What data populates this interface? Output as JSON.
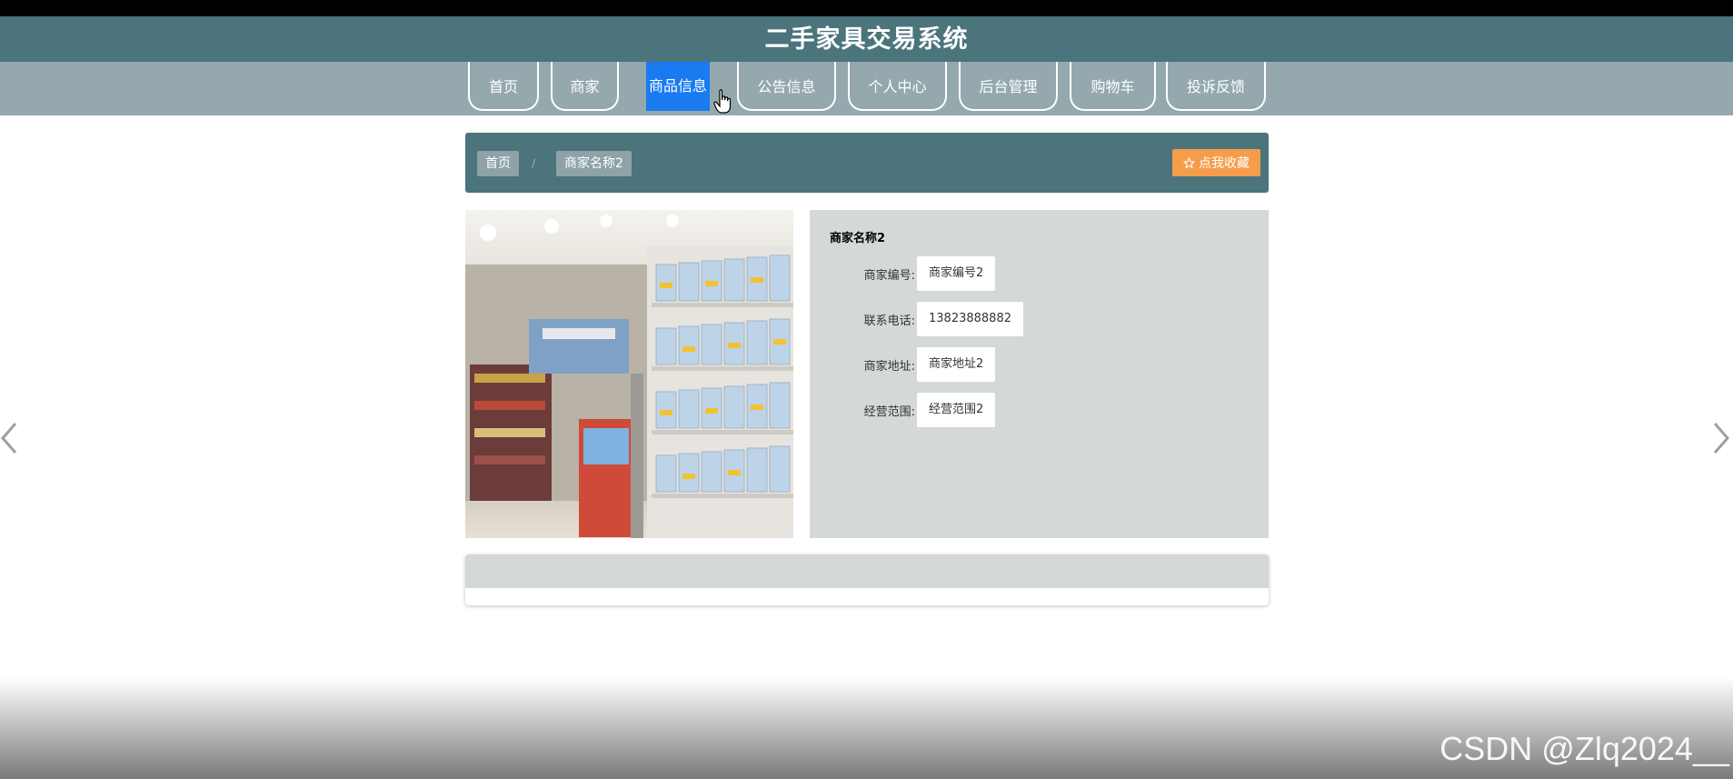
{
  "header": {
    "title": "二手家具交易系统"
  },
  "nav": {
    "items": [
      {
        "label": "首页"
      },
      {
        "label": "商家"
      },
      {
        "label": "商品信息"
      },
      {
        "label": "公告信息"
      },
      {
        "label": "个人中心"
      },
      {
        "label": "后台管理"
      },
      {
        "label": "购物车"
      },
      {
        "label": "投诉反馈"
      }
    ],
    "active_index": 2
  },
  "breadcrumb": {
    "home": "首页",
    "separator": "/",
    "current": "商家名称2",
    "favorite_button": "点我收藏"
  },
  "merchant": {
    "name": "商家名称2",
    "fields": [
      {
        "label": "商家编号:",
        "value": "商家编号2"
      },
      {
        "label": "联系电话:",
        "value": "13823888882"
      },
      {
        "label": "商家地址:",
        "value": "商家地址2"
      },
      {
        "label": "经营范围:",
        "value": "经营范围2"
      }
    ]
  },
  "watermark": "CSDN @Zlq2024__",
  "colors": {
    "header": "#4b747c",
    "nav": "#94a8ae",
    "active": "#1a7bf0",
    "favorite": "#f59d4b",
    "panel": "#d4d8d8"
  }
}
